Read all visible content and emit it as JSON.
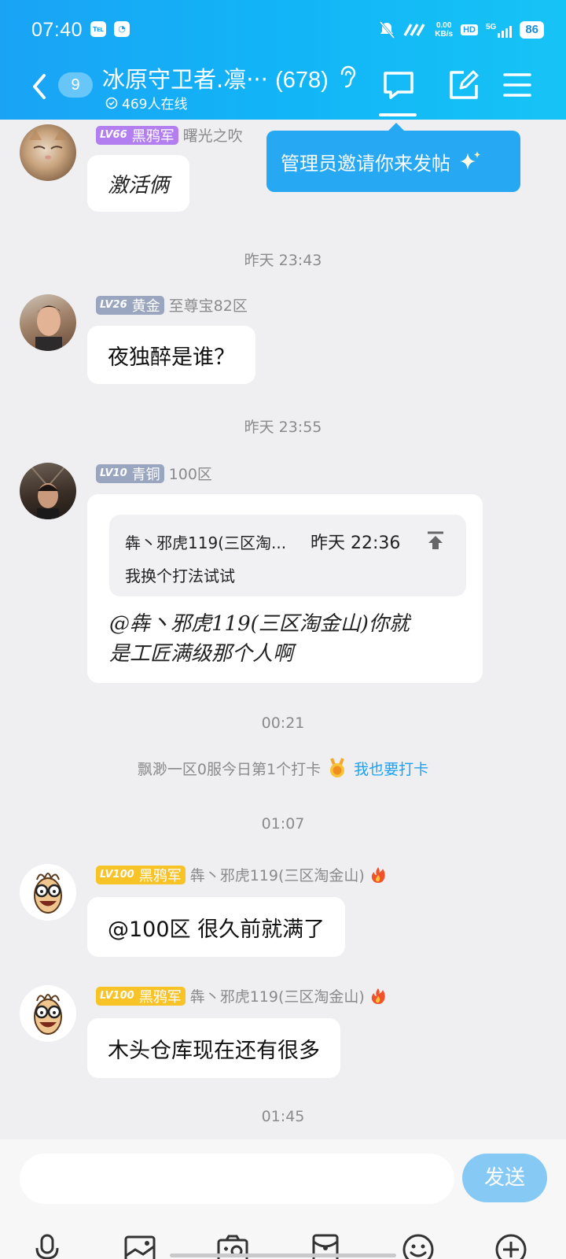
{
  "status_bar": {
    "time": "07:40",
    "net_speed_value": "0.00",
    "net_speed_unit": "KB/s",
    "hd": "HD",
    "network": "5G",
    "battery": "86"
  },
  "header": {
    "unread_count": "9",
    "group_name": "冰原守卫者.凛···",
    "member_count": "(678)",
    "online_text": "469人在线"
  },
  "tooltip": {
    "text": "管理员邀请你来发帖"
  },
  "messages": [
    {
      "level": "LV66",
      "title": "黑鸦军",
      "nickname": "曙光之吹",
      "text": "激活俩"
    },
    {
      "timestamp": "昨天 23:43",
      "level": "LV26",
      "title": "黄金",
      "nickname": "至尊宝82区",
      "text": "夜独醉是谁？"
    },
    {
      "timestamp": "昨天 23:55",
      "level": "LV10",
      "title": "青铜",
      "nickname": "100区",
      "quote_author": "犇丶邪虎119(三区淘...",
      "quote_time": "昨天 22:36",
      "quote_text": "我换个打法试试",
      "text_line1": "@犇丶邪虎119(三区淘金山)你就",
      "text_line2": "是工匠满级那个人啊"
    },
    {
      "timestamp": "00:21"
    },
    {
      "checkin_text": "飘渺一区0服今日第1个打卡",
      "checkin_link": "我也要打卡"
    },
    {
      "timestamp": "01:07",
      "level": "LV100",
      "title": "黑鸦军",
      "nickname": "犇丶邪虎119(三区淘金山)",
      "text": "@100区 很久前就满了"
    },
    {
      "level": "LV100",
      "title": "黑鸦军",
      "nickname": "犇丶邪虎119(三区淘金山)",
      "text": "木头仓库现在还有很多"
    },
    {
      "timestamp": "01:45"
    }
  ],
  "composer": {
    "placeholder": "",
    "send_label": "发送"
  },
  "toolbar_icons": [
    "microphone-icon",
    "image-icon",
    "camera-icon",
    "red-packet-icon",
    "emoji-icon",
    "plus-icon"
  ],
  "colors": {
    "accent": "#1aa3f5",
    "send_button": "#86c9f5",
    "background": "#efeff1"
  }
}
